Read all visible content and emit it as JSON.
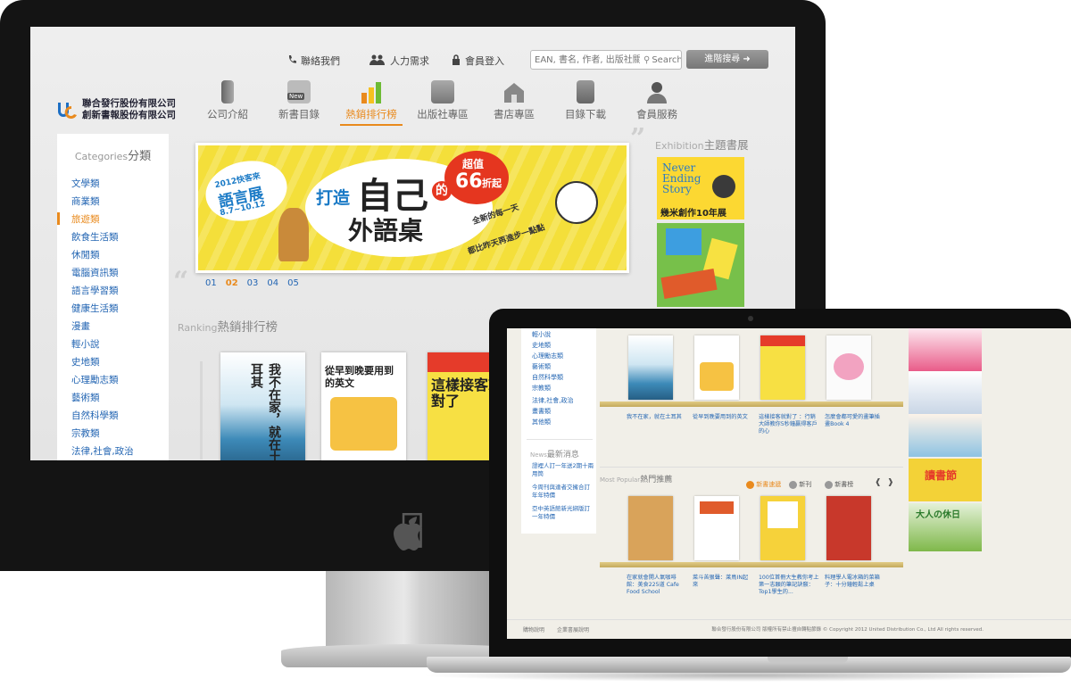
{
  "top_nav": {
    "contact": "聯絡我們",
    "jobs": "人力需求",
    "login": "會員登入",
    "search_placeholder": "EAN, 書名, 作者, 出版社關鍵字",
    "search_button": "Search",
    "advanced_search": "進階搜尋"
  },
  "logo": {
    "line1": "聯合發行股份有限公司",
    "line2": "創新書報股份有限公司"
  },
  "main_nav": [
    "公司介紹",
    "新書目錄",
    "熱銷排行榜",
    "出版社專區",
    "書店專區",
    "目錄下載",
    "會員服務"
  ],
  "main_nav_active": "熱銷排行榜",
  "new_badge": "New",
  "categories": {
    "title_en": "Categories",
    "title_zh": "分類",
    "selected": "旅遊類",
    "items": [
      "文學類",
      "商業類",
      "旅遊類",
      "飲食生活類",
      "休閒類",
      "電腦資訊類",
      "語言學習類",
      "健康生活類",
      "漫畫",
      "輕小說",
      "史地類",
      "心理勵志類",
      "藝術類",
      "自然科學類",
      "宗教類",
      "法律,社會,政治"
    ]
  },
  "banner": {
    "year_tag": "2012快客來",
    "title": "語言展",
    "dates": "8.7~10.12",
    "headline_a": "打造",
    "headline_b": "自己",
    "headline_c": "的",
    "headline_d": "外語桌",
    "price_a": "超值",
    "price_b": "66",
    "price_c": "折起",
    "slogan_a": "全新的每一天",
    "slogan_b": "都比昨天再進步一點點"
  },
  "banner_pager": {
    "pages": [
      "01",
      "02",
      "03",
      "04",
      "05"
    ],
    "current": "02"
  },
  "exhibition": {
    "title_en": "Exhibition",
    "title_zh": "主題書展",
    "card1_line1": "Never",
    "card1_line2": "Ending",
    "card1_line3": "Story",
    "card1_sub": "幾米創作10年展"
  },
  "ranking": {
    "title_en": "Ranking",
    "title_zh": "熱銷排行榜"
  },
  "ranking_books": [
    {
      "title": "我不在家，就在土耳其"
    },
    {
      "title": "從早到晚要用到的英文"
    },
    {
      "title": "這樣接客就對了"
    }
  ],
  "laptop": {
    "categories": [
      "輕小說",
      "史地類",
      "心理勵志類",
      "藝術類",
      "自然科學類",
      "宗教類",
      "法律,社會,政治",
      "畫書類",
      "其他類"
    ],
    "news_title_en": "News",
    "news_title_zh": "最新消息",
    "news": [
      "證裡人訂一年送2期十兩用筒",
      "今周刊與達者交擁合訂年年特價",
      "亞中英語館新光綁版訂一年特價"
    ],
    "row1_captions": [
      "我不在家，就在土耳其",
      "從早到晚要用到的英文",
      "這樣接客就對了 ：行銷大師教你5秒鐘贏得客戶的心",
      "怎麼會都可愛的畫筆插畫Book 4"
    ],
    "popular_en": "Most Popular",
    "popular_zh": "熱門推薦",
    "tabs": [
      "新書速遞",
      "新刊",
      "新書榜"
    ],
    "row2_captions": [
      "在家就會開人氣咖啡館：美食225道 Cafe Food School",
      "菜斗苦狠聲：莱鳥IN起來",
      "100位首冊大生教你考上第一志願的筆記訣竅：Top1學生的...",
      "料理學人電冰箱的菜箱子：十分鐘輕鬆上桌"
    ],
    "footer_left": [
      "購物說明",
      "企業書展說明"
    ],
    "footer_right": "聯合發行股份有限公司 版權所有禁止擅自轉貼節錄 © Copyright 2012 United Distribution Co., Ltd All rights reserved.",
    "ad_titles": [
      "讀書節",
      "大人の休日"
    ]
  }
}
